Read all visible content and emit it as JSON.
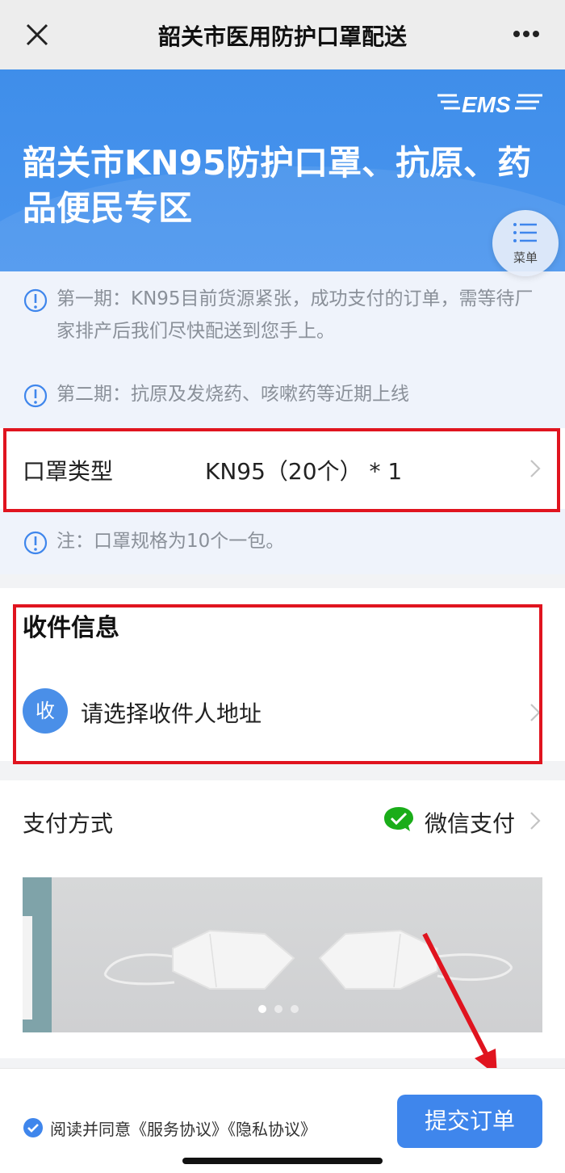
{
  "titlebar": {
    "title": "韶关市医用防护口罩配送"
  },
  "hero": {
    "logo_text": "EMS",
    "heading": "韶关市KN95防护口罩、抗原、药品便民专区",
    "menu_label": "菜单"
  },
  "notices": [
    {
      "text": "第一期：KN95目前货源紧张，成功支付的订单，需等待厂家排产后我们尽快配送到您手上。"
    },
    {
      "text": "第二期：抗原及发烧药、咳嗽药等近期上线"
    },
    {
      "text": "注：口罩规格为10个一包。"
    }
  ],
  "mask": {
    "label": "口罩类型",
    "value": "KN95（20个） * 1"
  },
  "recipient": {
    "heading": "收件信息",
    "avatar_char": "收",
    "placeholder": "请选择收件人地址"
  },
  "payment": {
    "label": "支付方式",
    "method": "微信支付"
  },
  "banner": {
    "slide_count": 3,
    "active_slide": 1
  },
  "footer": {
    "agreement": "阅读并同意《服务协议》《隐私协议》",
    "submit_label": "提交订单"
  },
  "colors": {
    "brand_blue": "#3f86ec",
    "highlight_red": "#e0141f",
    "wechat_green": "#1aad19"
  }
}
